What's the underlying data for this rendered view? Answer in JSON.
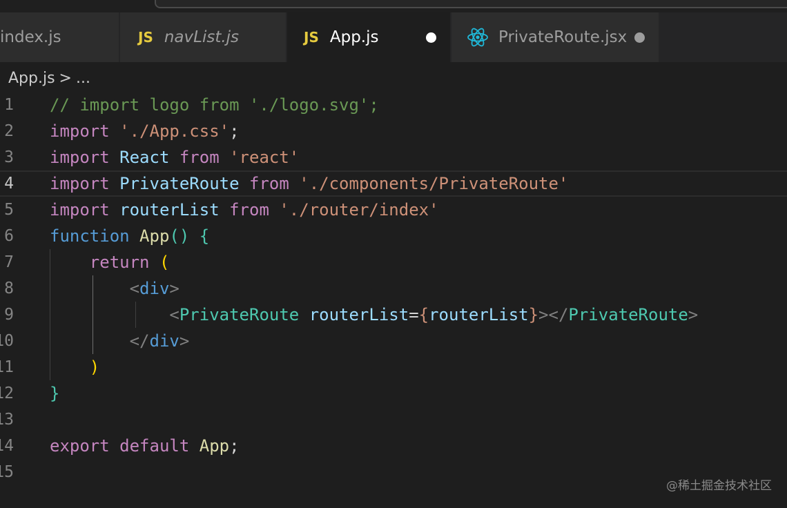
{
  "tabs": [
    {
      "label": "index.js",
      "icon": "none",
      "italic": false,
      "active": false
    },
    {
      "label": "navList.js",
      "icon": "js-icon",
      "italic": true,
      "active": false
    },
    {
      "label": "App.js",
      "icon": "js-icon",
      "italic": false,
      "active": true,
      "dirty": true
    },
    {
      "label": "PrivateRoute.jsx",
      "icon": "react-icon",
      "italic": false,
      "active": false,
      "dirty": true
    }
  ],
  "js_badge": "JS",
  "breadcrumb": {
    "file": "App.js",
    "separator": ">",
    "more": "..."
  },
  "current_line": 4,
  "colors": {
    "comment": "#6a9955",
    "keyword": "#c586c0",
    "string": "#ce9178",
    "variable": "#9cdcfe",
    "function": "#dcdcaa",
    "storage": "#569cd6",
    "tag": "#4ec9b0",
    "bracket_gold": "#ffd700",
    "bracket_purple": "#da70d6",
    "bracket_blue": "#179fff",
    "punct": "#808080",
    "plain": "#d4d4d4"
  },
  "code_lines": [
    {
      "num": "1",
      "tokens": [
        {
          "t": "// import logo from './logo.svg';",
          "c": "comment"
        }
      ]
    },
    {
      "num": "2",
      "tokens": [
        {
          "t": "import",
          "c": "keyword"
        },
        {
          "t": " ",
          "c": "plain"
        },
        {
          "t": "'./App.css'",
          "c": "string"
        },
        {
          "t": ";",
          "c": "plain"
        }
      ]
    },
    {
      "num": "3",
      "tokens": [
        {
          "t": "import",
          "c": "keyword"
        },
        {
          "t": " ",
          "c": "plain"
        },
        {
          "t": "React",
          "c": "variable"
        },
        {
          "t": " ",
          "c": "plain"
        },
        {
          "t": "from",
          "c": "keyword"
        },
        {
          "t": " ",
          "c": "plain"
        },
        {
          "t": "'react'",
          "c": "string"
        }
      ]
    },
    {
      "num": "4",
      "tokens": [
        {
          "t": "import",
          "c": "keyword"
        },
        {
          "t": " ",
          "c": "plain"
        },
        {
          "t": "PrivateRoute",
          "c": "variable"
        },
        {
          "t": " ",
          "c": "plain"
        },
        {
          "t": "from",
          "c": "keyword"
        },
        {
          "t": " ",
          "c": "plain"
        },
        {
          "t": "'./components/PrivateRoute'",
          "c": "string"
        }
      ]
    },
    {
      "num": "5",
      "tokens": [
        {
          "t": "import",
          "c": "keyword"
        },
        {
          "t": " ",
          "c": "plain"
        },
        {
          "t": "routerList",
          "c": "variable"
        },
        {
          "t": " ",
          "c": "plain"
        },
        {
          "t": "from",
          "c": "keyword"
        },
        {
          "t": " ",
          "c": "plain"
        },
        {
          "t": "'./router/index'",
          "c": "string"
        }
      ]
    },
    {
      "num": "6",
      "tokens": [
        {
          "t": "function",
          "c": "storage"
        },
        {
          "t": " ",
          "c": "plain"
        },
        {
          "t": "App",
          "c": "function"
        },
        {
          "t": "()",
          "c": "tag"
        },
        {
          "t": " ",
          "c": "plain"
        },
        {
          "t": "{",
          "c": "tag"
        }
      ]
    },
    {
      "num": "7",
      "tokens": [
        {
          "t": "    ",
          "c": "plain"
        },
        {
          "t": "return",
          "c": "keyword"
        },
        {
          "t": " ",
          "c": "plain"
        },
        {
          "t": "(",
          "c": "bracket_gold"
        }
      ]
    },
    {
      "num": "8",
      "tokens": [
        {
          "t": "        ",
          "c": "plain"
        },
        {
          "t": "<",
          "c": "punct"
        },
        {
          "t": "div",
          "c": "storage"
        },
        {
          "t": ">",
          "c": "punct"
        }
      ]
    },
    {
      "num": "9",
      "tokens": [
        {
          "t": "            ",
          "c": "plain"
        },
        {
          "t": "<",
          "c": "punct"
        },
        {
          "t": "PrivateRoute",
          "c": "tag"
        },
        {
          "t": " ",
          "c": "plain"
        },
        {
          "t": "routerList",
          "c": "variable"
        },
        {
          "t": "=",
          "c": "plain"
        },
        {
          "t": "{",
          "c": "string"
        },
        {
          "t": "routerList",
          "c": "variable"
        },
        {
          "t": "}",
          "c": "string"
        },
        {
          "t": "></",
          "c": "punct"
        },
        {
          "t": "PrivateRoute",
          "c": "tag"
        },
        {
          "t": ">",
          "c": "punct"
        }
      ]
    },
    {
      "num": "10",
      "tokens": [
        {
          "t": "        ",
          "c": "plain"
        },
        {
          "t": "</",
          "c": "punct"
        },
        {
          "t": "div",
          "c": "storage"
        },
        {
          "t": ">",
          "c": "punct"
        }
      ]
    },
    {
      "num": "11",
      "tokens": [
        {
          "t": "    ",
          "c": "plain"
        },
        {
          "t": ")",
          "c": "bracket_gold"
        }
      ]
    },
    {
      "num": "12",
      "tokens": [
        {
          "t": "}",
          "c": "tag"
        }
      ]
    },
    {
      "num": "13",
      "tokens": []
    },
    {
      "num": "14",
      "tokens": [
        {
          "t": "export",
          "c": "keyword"
        },
        {
          "t": " ",
          "c": "plain"
        },
        {
          "t": "default",
          "c": "keyword"
        },
        {
          "t": " ",
          "c": "plain"
        },
        {
          "t": "App",
          "c": "function"
        },
        {
          "t": ";",
          "c": "plain"
        }
      ]
    },
    {
      "num": "15",
      "tokens": []
    }
  ],
  "watermark": "@稀土掘金技术社区"
}
